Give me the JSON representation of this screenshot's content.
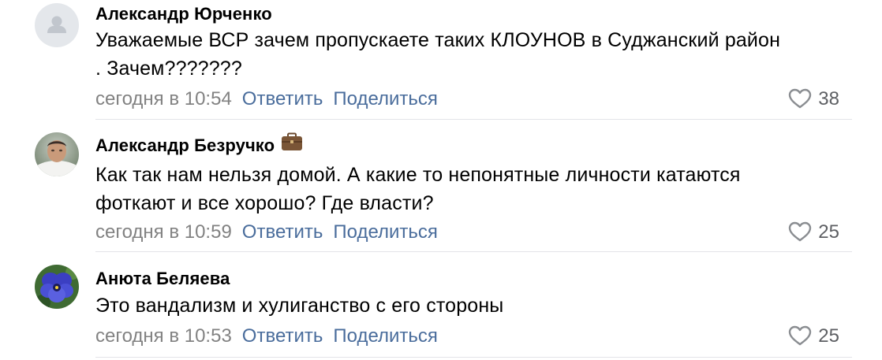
{
  "comments": [
    {
      "author": "Александр Юрченко",
      "text_lines": [
        "Уважаемые ВСР зачем пропускаете таких КЛОУНОВ в Суджанский район",
        ". Зачем???????"
      ],
      "time": "сегодня в 10:54",
      "reply_label": "Ответить",
      "share_label": "Поделиться",
      "likes": "38",
      "avatar": "default-user-icon"
    },
    {
      "author": "Александр Безручко",
      "badge": "briefcase-icon",
      "text_lines": [
        "Как так нам нельзя домой. А какие то непонятные личности катаются",
        "фоткают и все хорошо? Где власти?"
      ],
      "time": "сегодня в 10:59",
      "reply_label": "Ответить",
      "share_label": "Поделиться",
      "likes": "25",
      "avatar": "user-photo"
    },
    {
      "author": "Анюта Беляева",
      "text_lines": [
        "Это вандализм и хулиганство с его стороны"
      ],
      "time": "сегодня в 10:53",
      "reply_label": "Ответить",
      "share_label": "Поделиться",
      "likes": "25",
      "avatar": "pansy-flower-photo"
    }
  ],
  "colors": {
    "link": "#4a6d9c",
    "meta": "#828282",
    "likes": "#5d5f63",
    "divider": "#e3e4e8"
  }
}
